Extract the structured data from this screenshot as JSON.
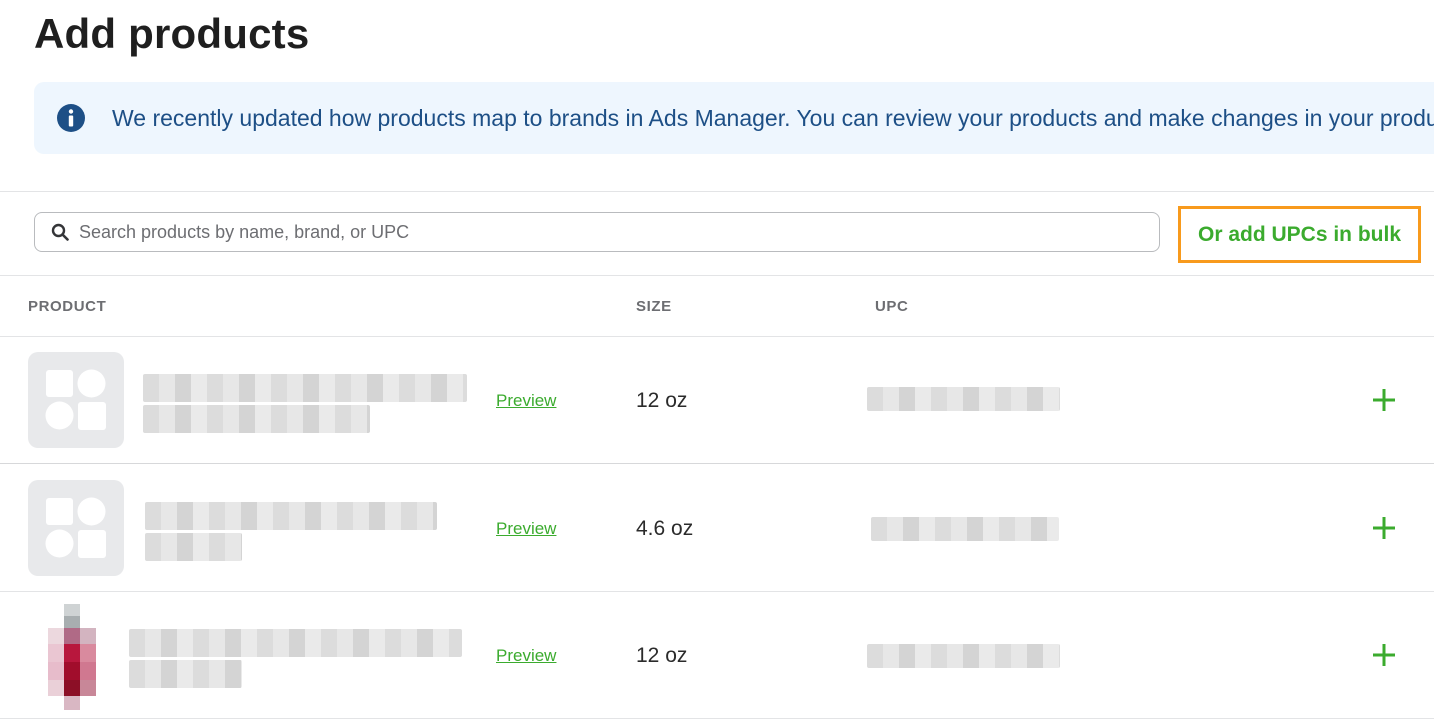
{
  "page": {
    "title": "Add products"
  },
  "banner": {
    "text": "We recently updated how products map to brands in Ads Manager. You can review your products and make changes in your product list.",
    "icon": "info-icon",
    "color": "#1d4f86",
    "background": "#eef6fe"
  },
  "search": {
    "placeholder": "Search products by name, brand, or UPC",
    "value": "",
    "icon": "search-icon"
  },
  "bulk_button": {
    "label": "Or add UPCs in bulk",
    "color": "#3bab2e",
    "highlight": "#f89a1c"
  },
  "table": {
    "headers": {
      "product": "PRODUCT",
      "size": "SIZE",
      "upc": "UPC"
    },
    "rows": [
      {
        "image": "placeholder-icon",
        "name_redacted": true,
        "preview": "Preview",
        "size": "12 oz",
        "upc_redacted": true
      },
      {
        "image": "placeholder-icon",
        "name_redacted": true,
        "preview": "Preview",
        "size": "4.6 oz",
        "upc_redacted": true
      },
      {
        "image": "product-bottle-image",
        "name_redacted": true,
        "preview": "Preview",
        "size": "12 oz",
        "upc_redacted": true
      }
    ]
  },
  "accent_color": "#3bab2e"
}
